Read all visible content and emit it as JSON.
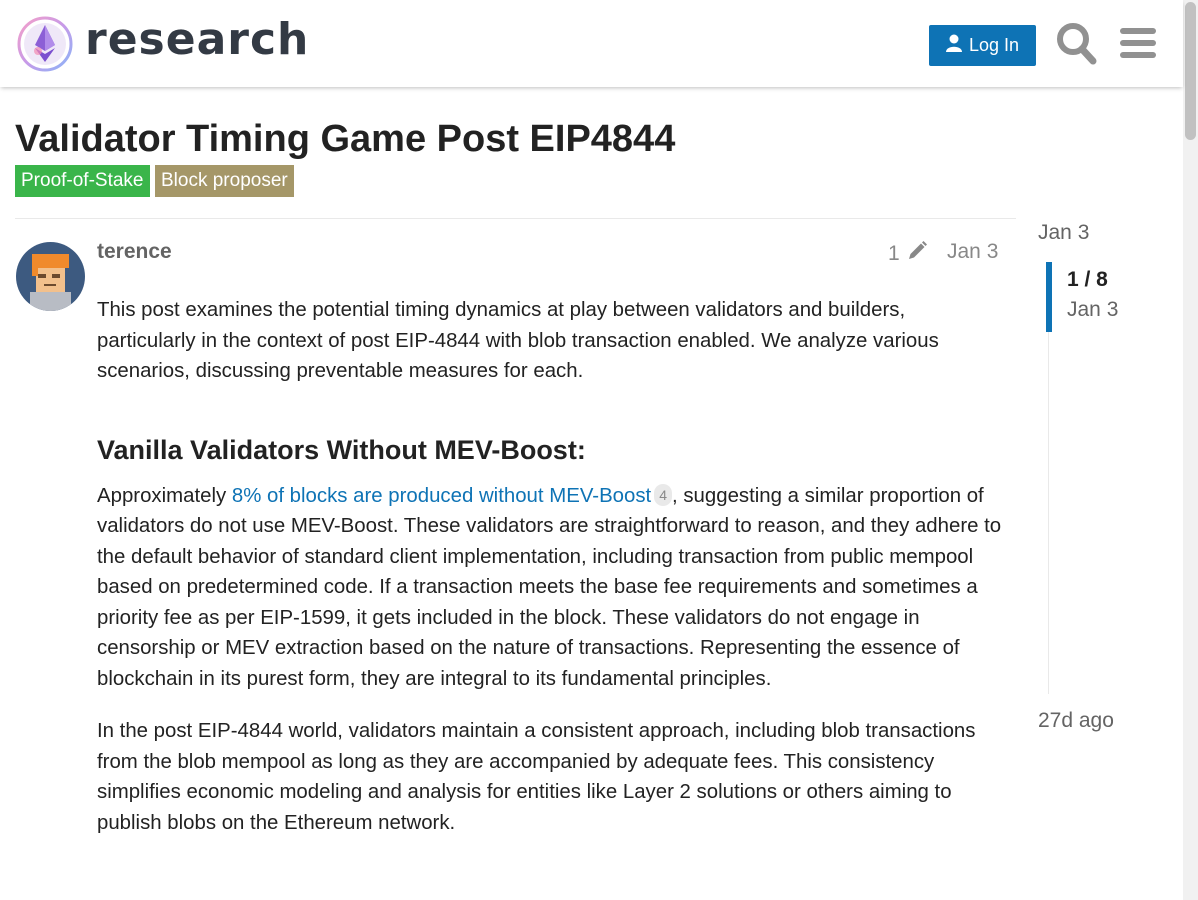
{
  "header": {
    "logo_text": "research",
    "login_label": "Log In"
  },
  "topic": {
    "title": "Validator Timing Game Post EIP4844",
    "tags": [
      {
        "label": "Proof-of-Stake",
        "color": "#3ab54a"
      },
      {
        "label": "Block proposer",
        "color": "#a59768"
      }
    ]
  },
  "post": {
    "username": "terence",
    "edit_count": "1",
    "date": "Jan 3",
    "intro": "This post examines the potential timing dynamics at play between validators and builders, particularly in the context of post EIP-4844 with blob transaction enabled. We analyze various scenarios, discussing preventable measures for each.",
    "heading": "Vanilla Validators Without MEV-Boost:",
    "para1_prefix": "Approximately ",
    "para1_link": "8% of blocks are produced without MEV-Boost",
    "para1_link_clicks": "4",
    "para1_suffix": ", suggesting a similar proportion of validators do not use MEV-Boost. These validators are straightforward to reason, and they adhere to the default behavior of standard client implementation, including transaction from public mempool based on predetermined code. If a transaction meets the base fee requirements and sometimes a priority fee as per EIP-1599, it gets included in the block. These validators do not engage in censorship or MEV extraction based on the nature of transactions. Representing the essence of blockchain in its purest form, they are integral to its fundamental principles.",
    "para2": "In the post EIP-4844 world, validators maintain a consistent approach, including blob transactions from the blob mempool as long as they are accompanied by adequate fees. This consistency simplifies economic modeling and analysis for entities like Layer 2 solutions or others aiming to publish blobs on the Ethereum network."
  },
  "timeline": {
    "start_date": "Jan 3",
    "progress": "1 / 8",
    "handle_date": "Jan 3",
    "end_label": "27d ago"
  },
  "colors": {
    "accent": "#0e73b5",
    "text": "#222222",
    "muted": "#646464"
  },
  "icons": [
    "user-icon",
    "search-icon",
    "hamburger-menu-icon",
    "pencil-icon"
  ]
}
